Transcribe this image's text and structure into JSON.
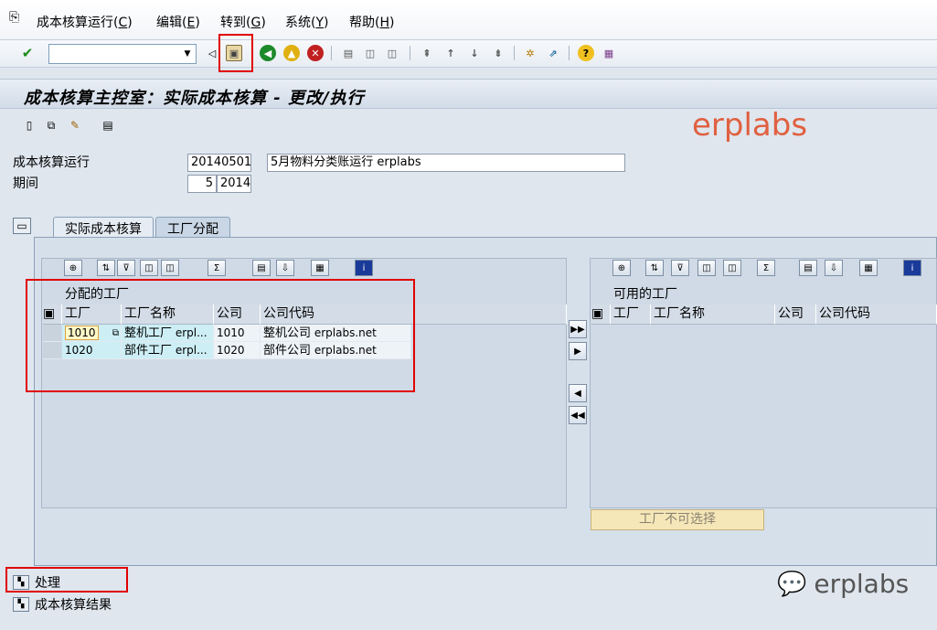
{
  "menu": {
    "items": [
      {
        "label": "成本核算运行(",
        "accel": "C",
        "tail": ")"
      },
      {
        "label": "编辑(",
        "accel": "E",
        "tail": ")"
      },
      {
        "label": "转到(",
        "accel": "G",
        "tail": ")"
      },
      {
        "label": "系统(",
        "accel": "Y",
        "tail": ")"
      },
      {
        "label": "帮助(",
        "accel": "H",
        "tail": ")"
      }
    ]
  },
  "toolbar": {
    "command_value": "",
    "icons": [
      "enter-icon",
      "save-icon",
      "back-icon",
      "exit-icon",
      "cancel-icon",
      "print-icon",
      "find-icon",
      "find-next-icon",
      "first-page-icon",
      "prev-page-icon",
      "next-page-icon",
      "last-page-icon",
      "new-session-icon",
      "shortcut-icon",
      "help-icon",
      "layout-icon"
    ]
  },
  "title": "成本核算主控室：实际成本核算 - 更改/执行",
  "watermark_top": "erplabs",
  "form": {
    "run_label": "成本核算运行",
    "run_value": "20140501",
    "run_desc": "5月物料分类账运行 erplabs",
    "period_label": "期间",
    "period_value": "5",
    "year_value": "2014"
  },
  "tabs": [
    {
      "label": "实际成本核算"
    },
    {
      "label": "工厂分配"
    }
  ],
  "assigned": {
    "title": "分配的工厂",
    "columns": [
      "工厂",
      "工厂名称",
      "公司",
      "公司代码"
    ],
    "rows": [
      {
        "plant": "1010",
        "plant_name": "整机工厂",
        "plant_name_suffix": "erpl...",
        "company": "1010",
        "company_name": "整机公司",
        "company_suffix": "erplabs.net"
      },
      {
        "plant": "1020",
        "plant_name": "部件工厂",
        "plant_name_suffix": "erpl...",
        "company": "1020",
        "company_name": "部件公司",
        "company_suffix": "erplabs.net"
      }
    ]
  },
  "available": {
    "title": "可用的工厂",
    "columns": [
      "工厂",
      "工厂名称",
      "公司",
      "公司代码"
    ],
    "button": "工厂不可选择"
  },
  "bottom": {
    "process": "处理",
    "result": "成本核算结果"
  },
  "watermark_bottom": "erplabs",
  "colors": {
    "highlight": "#e00000",
    "watermark": "#e06040"
  }
}
